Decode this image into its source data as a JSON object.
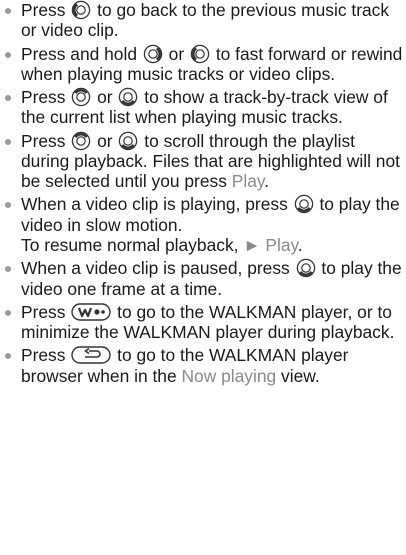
{
  "colors": {
    "text": "#1a1a1a",
    "bullet": "#9a9a9a",
    "highlight": "#8a8a8a"
  },
  "items": [
    {
      "segments": [
        {
          "t": "Press "
        },
        {
          "icon": "nav-left-icon"
        },
        {
          "t": " to go back to the previous music track or video clip."
        }
      ]
    },
    {
      "segments": [
        {
          "t": "Press and hold "
        },
        {
          "icon": "nav-right-icon"
        },
        {
          "t": " or "
        },
        {
          "icon": "nav-left-icon"
        },
        {
          "t": " to fast forward or rewind when playing music tracks or video clips."
        }
      ]
    },
    {
      "segments": [
        {
          "t": "Press "
        },
        {
          "icon": "nav-up-icon"
        },
        {
          "t": " or "
        },
        {
          "icon": "nav-down-icon"
        },
        {
          "t": " to show a track-by-track view of the current list when playing music tracks."
        }
      ]
    },
    {
      "segments": [
        {
          "t": "Press "
        },
        {
          "icon": "nav-up-icon"
        },
        {
          "t": " or "
        },
        {
          "icon": "nav-down-icon"
        },
        {
          "t": " to scroll through the playlist during playback. Files that are highlighted will not be selected until you press "
        },
        {
          "t": "Play",
          "style": "gray"
        },
        {
          "t": "."
        }
      ]
    },
    {
      "segments": [
        {
          "t": "When a video clip is playing, press "
        },
        {
          "icon": "nav-down-icon"
        },
        {
          "t": " to play the video in slow motion."
        },
        {
          "br": true
        },
        {
          "t": "To resume normal playback, "
        },
        {
          "t": "► Play",
          "style": "gray"
        },
        {
          "t": "."
        }
      ]
    },
    {
      "segments": [
        {
          "t": "When a video clip is paused, press "
        },
        {
          "icon": "nav-down-icon"
        },
        {
          "t": " to play the video one frame at a time."
        }
      ]
    },
    {
      "segments": [
        {
          "t": "Press "
        },
        {
          "icon": "walkman-key-icon"
        },
        {
          "t": " to go to the WALKMAN player, or to minimize the WALKMAN player during playback."
        }
      ]
    },
    {
      "segments": [
        {
          "t": "Press "
        },
        {
          "icon": "back-key-icon"
        },
        {
          "t": " to go to the WALKMAN player browser when in the "
        },
        {
          "t": "Now playing",
          "style": "gray"
        },
        {
          "t": " view."
        }
      ]
    }
  ]
}
